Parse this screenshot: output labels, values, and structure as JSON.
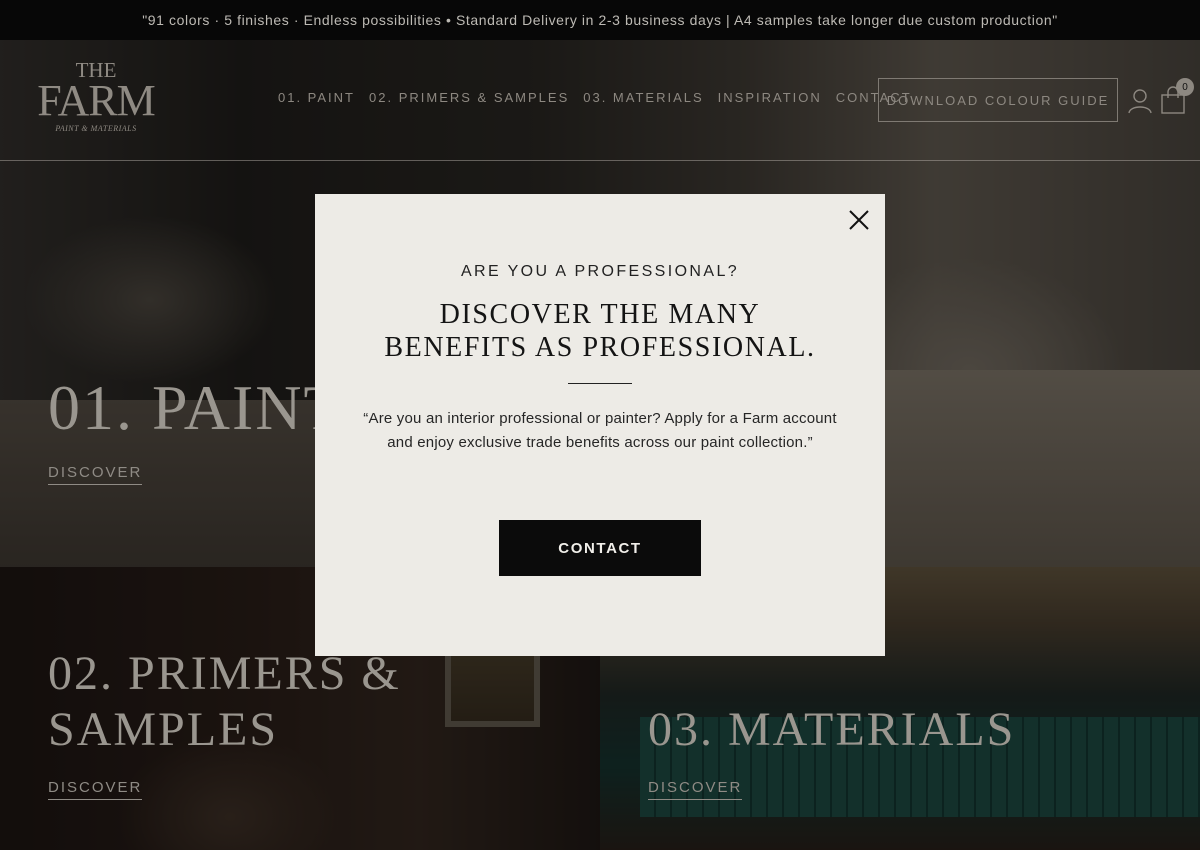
{
  "announcement": "\"91 colors · 5 finishes · Endless possibilities • Standard Delivery in 2-3 business days | A4 samples take longer due custom production\"",
  "logo": {
    "line1": "THE",
    "line2": "FARM",
    "line3": "PAINT & MATERIALS"
  },
  "nav": {
    "items": [
      {
        "label": "01. PAINT"
      },
      {
        "label": "02. PRIMERS & SAMPLES"
      },
      {
        "label": "03. MATERIALS"
      },
      {
        "label": "INSPIRATION"
      },
      {
        "label": "CONTACT"
      }
    ],
    "download_label": "DOWNLOAD COLOUR GUIDE",
    "cart_count": "0"
  },
  "panels": {
    "paint": {
      "title": "01. PAINT",
      "link": "DISCOVER"
    },
    "primers": {
      "title_line1": "02. PRIMERS &",
      "title_line2": "SAMPLES",
      "link": "DISCOVER"
    },
    "materials": {
      "title": "03. MATERIALS",
      "link": "DISCOVER"
    }
  },
  "modal": {
    "eyebrow": "ARE YOU A PROFESSIONAL?",
    "headline_line1": "DISCOVER THE MANY",
    "headline_line2": "BENEFITS AS PROFESSIONAL.",
    "body": "“Are you an interior professional or painter? Apply for a Farm account and enjoy exclusive trade benefits across our paint collection.”",
    "cta_label": "CONTACT"
  },
  "icons": {
    "close": "close-icon",
    "user": "user-icon",
    "cart": "shopping-bag-icon"
  },
  "colors": {
    "modal_bg": "#edebe6",
    "cta_bg": "#0b0b0b",
    "announcement_bg": "#070707"
  }
}
